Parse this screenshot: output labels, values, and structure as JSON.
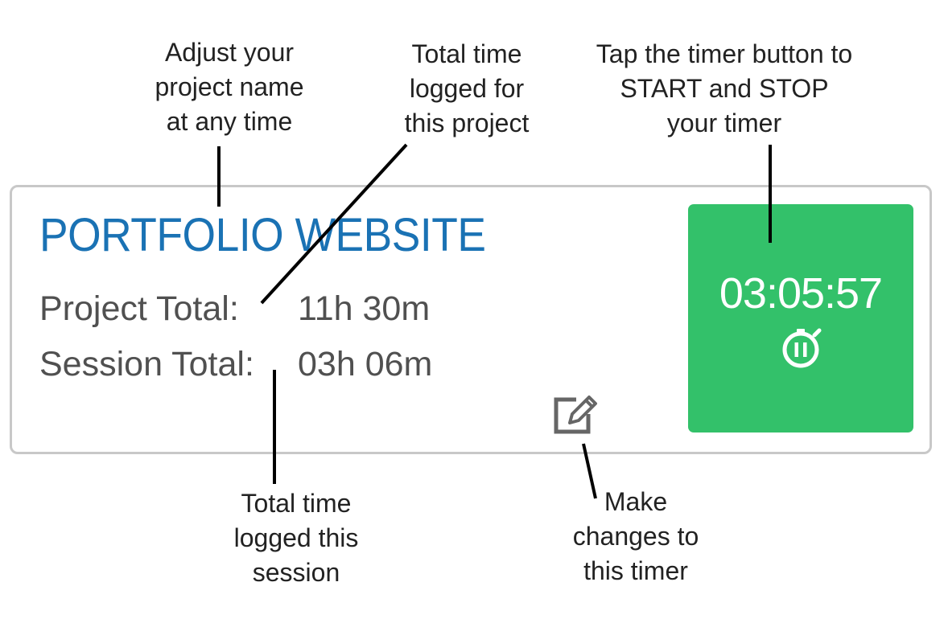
{
  "card": {
    "project_name": "PORTFOLIO WEBSITE",
    "project_total_label": "Project Total:",
    "project_total_value": "11h 30m",
    "session_total_label": "Session Total:",
    "session_total_value": "03h 06m",
    "timer": {
      "display": "03:05:57",
      "icon": "stopwatch-pause-icon"
    },
    "edit_icon": "edit-icon"
  },
  "annotations": {
    "project_name": "Adjust your\nproject name\nat any time",
    "project_total": "Total time\nlogged for\nthis project",
    "timer_button": "Tap the timer button to\nSTART and STOP\nyour timer",
    "session_total": "Total time\nlogged this\nsession",
    "edit": "Make\nchanges to\nthis timer"
  },
  "colors": {
    "project_name": "#1a72b4",
    "timer_button": "#33c16a",
    "card_border": "#c8c8c8",
    "stat_text": "#505050"
  }
}
